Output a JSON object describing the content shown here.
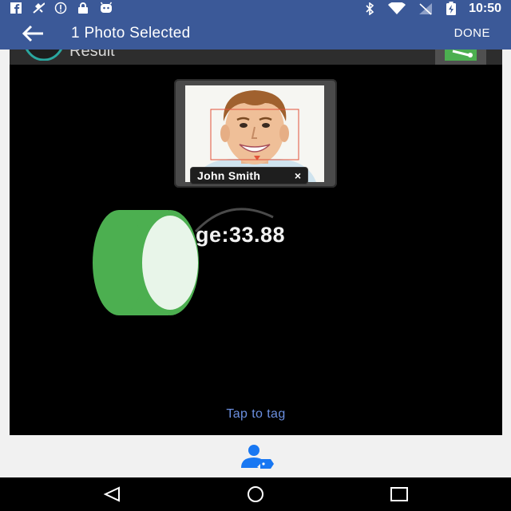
{
  "status_bar": {
    "time": "10:50",
    "left_icons": [
      "facebook-icon",
      "no-location-icon",
      "info-circle-icon",
      "lock-icon",
      "android-icon"
    ],
    "right_icons": [
      "bluetooth-icon",
      "wifi-icon",
      "no-signal-icon",
      "battery-charging-icon"
    ]
  },
  "app_bar": {
    "title": "1 Photo Selected",
    "done_label": "DONE",
    "background": "#3b5998"
  },
  "result_bar": {
    "label": "Result"
  },
  "photo": {
    "tag_name": "John Smith",
    "tag_close": "×"
  },
  "age": {
    "text": "ge:33.88"
  },
  "tap_to_tag": "Tap to tag",
  "colors": {
    "accent": "#3b5998",
    "green": "#4caf50",
    "link": "#6b8fe0",
    "tag_icon": "#1877f2"
  }
}
